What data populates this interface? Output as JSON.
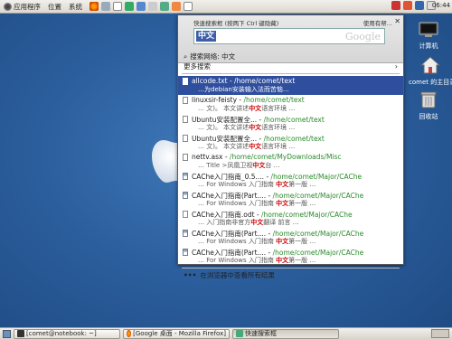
{
  "top_panel": {
    "menus": [
      "应用程序",
      "位置",
      "系统"
    ],
    "clock": "06:44"
  },
  "desktop_icons": [
    {
      "label": "计算机"
    },
    {
      "label": "comet 的主目录"
    },
    {
      "label": "回收站"
    }
  ],
  "popup": {
    "title": "快速搜索框 (按两下 Ctrl 键隐藏)",
    "help": "使用有帮...",
    "close": "✕",
    "query": "中文",
    "google_mark": "Google",
    "search_web_label": "搜索网络:  中文",
    "more_search_label": "更多搜索",
    "results": [
      {
        "name": "allcode.txt",
        "path": "/home/comet/text",
        "snippet_pre": "…为debian安装",
        "snippet_hl": "",
        "snippet_post": "输入法而苦恼…",
        "selected": true,
        "kind": "doc"
      },
      {
        "name": "linuxsir-feisty",
        "path": "/home/comet/text",
        "snippet_pre": "… 文)。 本文讲述",
        "snippet_hl": "中文",
        "snippet_post": "语言环境 …",
        "selected": false,
        "kind": "doc"
      },
      {
        "name": "Ubuntu安装配置全...",
        "path": "/home/comet/text",
        "snippet_pre": "… 文)。 本文讲述",
        "snippet_hl": "中文",
        "snippet_post": "语言环境 …",
        "selected": false,
        "kind": "doc"
      },
      {
        "name": "Ubuntu安装配置全...",
        "path": "/home/comet/text",
        "snippet_pre": "… 文)。 本文讲述",
        "snippet_hl": "中文",
        "snippet_post": "语言环境 …",
        "selected": false,
        "kind": "doc"
      },
      {
        "name": "nettv.asx",
        "path": "/home/comet/MyDownloads/Misc",
        "snippet_pre": "… Title >凤凰卫视",
        "snippet_hl": "中文",
        "snippet_post": "台 …",
        "selected": false,
        "kind": "doc"
      },
      {
        "name": "CAChe入门指南_0.5....",
        "path": "/home/comet/Major/CAChe",
        "snippet_pre": "… For Windows 入门指南 ",
        "snippet_hl": "中文",
        "snippet_post": "第一版 …",
        "selected": false,
        "kind": "img"
      },
      {
        "name": "CAChe入门指南(Part....",
        "path": "/home/comet/Major/CAChe",
        "snippet_pre": "… For Windows 入门指南 ",
        "snippet_hl": "中文",
        "snippet_post": "第一版 …",
        "selected": false,
        "kind": "img"
      },
      {
        "name": "CAChe入门指南.odt",
        "path": "/home/comet/Major/CAChe",
        "snippet_pre": "… 入门指南非官方",
        "snippet_hl": "中文",
        "snippet_post": "翻译 前言 …",
        "selected": false,
        "kind": "doc"
      },
      {
        "name": "CAChe入门指南(Part....",
        "path": "/home/comet/Major/CAChe",
        "snippet_pre": "… For Windows 入门指南 ",
        "snippet_hl": "中文",
        "snippet_post": "第一版 …",
        "selected": false,
        "kind": "img"
      },
      {
        "name": "CAChe入门指南(Part....",
        "path": "/home/comet/Major/CAChe",
        "snippet_pre": "… For Windows 入门指南 ",
        "snippet_hl": "中文",
        "snippet_post": "第一版 …",
        "selected": false,
        "kind": "img"
      }
    ],
    "footer_label": "在浏览器中查看所有结果",
    "footer_dots": "•••"
  },
  "taskbar": {
    "items": [
      {
        "label": "[comet@notebook: ~]"
      },
      {
        "label": "[Google 桌面 - Mozilla Firefox]"
      },
      {
        "label": "快速搜索框"
      }
    ]
  }
}
